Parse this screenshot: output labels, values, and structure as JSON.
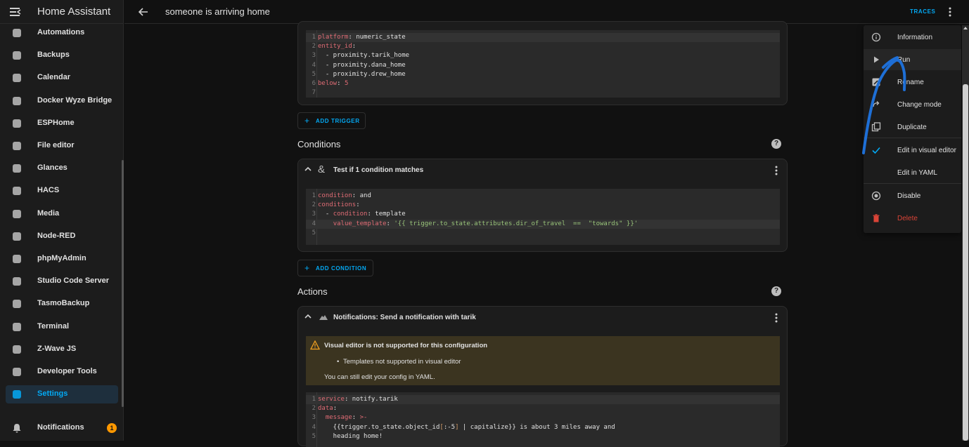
{
  "app": {
    "title": "Home Assistant"
  },
  "topbar": {
    "title": "someone is arriving home",
    "traces_label": "TRACES"
  },
  "sidebar": {
    "items": [
      {
        "label": "Automations",
        "icon": "robot-icon"
      },
      {
        "label": "Backups",
        "icon": "cloud-icon"
      },
      {
        "label": "Calendar",
        "icon": "calendar-icon"
      },
      {
        "label": "Docker Wyze Bridge",
        "icon": "puzzle-icon"
      },
      {
        "label": "ESPHome",
        "icon": "esphome-icon"
      },
      {
        "label": "File editor",
        "icon": "wrench-icon"
      },
      {
        "label": "Glances",
        "icon": "gauge-icon"
      },
      {
        "label": "HACS",
        "icon": "store-icon"
      },
      {
        "label": "Media",
        "icon": "media-icon"
      },
      {
        "label": "Node-RED",
        "icon": "sitemap-icon"
      },
      {
        "label": "phpMyAdmin",
        "icon": "database-icon"
      },
      {
        "label": "Studio Code Server",
        "icon": "vscode-icon"
      },
      {
        "label": "TasmoBackup",
        "icon": "restore-icon"
      },
      {
        "label": "Terminal",
        "icon": "terminal-icon"
      },
      {
        "label": "Z-Wave JS",
        "icon": "zwave-icon"
      },
      {
        "label": "Developer Tools",
        "icon": "hammer-icon"
      },
      {
        "label": "Settings",
        "icon": "gear-icon",
        "active": true
      }
    ],
    "notifications": {
      "label": "Notifications",
      "count": "1"
    }
  },
  "trigger_yaml": {
    "lines": [
      [
        [
          "platform",
          "k"
        ],
        [
          ": numeric_state",
          ""
        ]
      ],
      [
        [
          "entity_id",
          "k"
        ],
        [
          ":",
          ""
        ]
      ],
      [
        [
          "  - proximity.tarik_home",
          ""
        ]
      ],
      [
        [
          "  - proximity.dana_home",
          ""
        ]
      ],
      [
        [
          "  - proximity.drew_home",
          ""
        ]
      ],
      [
        [
          "below",
          "k"
        ],
        [
          ": ",
          ""
        ],
        [
          "5",
          "n"
        ]
      ],
      [
        [
          "",
          ""
        ]
      ]
    ]
  },
  "add_trigger_label": "ADD TRIGGER",
  "conditions": {
    "title": "Conditions",
    "card_title": "Test if 1 condition matches",
    "lines": [
      [
        [
          "condition",
          "k"
        ],
        [
          ": and",
          ""
        ]
      ],
      [
        [
          "conditions",
          "k"
        ],
        [
          ":",
          ""
        ]
      ],
      [
        [
          "  - ",
          ""
        ],
        [
          "condition",
          "k"
        ],
        [
          ": template",
          ""
        ]
      ],
      [
        [
          "    ",
          ""
        ],
        [
          "value_template",
          "k"
        ],
        [
          ": ",
          ""
        ],
        [
          "'{{ trigger.to_state.attributes.dir_of_travel  ==  \"towards\" }}'",
          "s"
        ]
      ],
      [
        [
          "",
          ""
        ]
      ]
    ],
    "add_label": "ADD CONDITION"
  },
  "actions": {
    "title": "Actions",
    "card_title": "Notifications: Send a notification with tarik",
    "warning": {
      "title": "Visual editor is not supported for this configuration",
      "bullet": "Templates not supported in visual editor",
      "sub": "You can still edit your config in YAML."
    },
    "lines": [
      [
        [
          "service",
          "k"
        ],
        [
          ": notify.tarik",
          ""
        ]
      ],
      [
        [
          "data",
          "k"
        ],
        [
          ":",
          ""
        ]
      ],
      [
        [
          "  ",
          ""
        ],
        [
          "message",
          "k"
        ],
        [
          ": ",
          ""
        ],
        [
          ">-",
          "k"
        ]
      ],
      [
        [
          "    {{trigger.to_state.object_id",
          ""
        ],
        [
          "[",
          "k2"
        ],
        [
          ":-5",
          ""
        ],
        [
          "]",
          "k2"
        ],
        [
          " | capitalize}} is about 3 miles away and",
          ""
        ]
      ],
      [
        [
          "    heading home!",
          ""
        ]
      ]
    ]
  },
  "menu": {
    "items": [
      {
        "label": "Information",
        "icon": "info-icon"
      },
      {
        "label": "Run",
        "icon": "play-icon"
      },
      {
        "label": "Rename",
        "icon": "rename-icon"
      },
      {
        "label": "Change mode",
        "icon": "redo-icon"
      },
      {
        "label": "Duplicate",
        "icon": "duplicate-icon"
      },
      {
        "label": "Edit in visual editor",
        "icon": "check-icon"
      },
      {
        "label": "Edit in YAML",
        "icon": ""
      },
      {
        "label": "Disable",
        "icon": "disable-icon"
      },
      {
        "label": "Delete",
        "icon": "trash-icon"
      }
    ]
  },
  "colors": {
    "accent": "#03a9f4",
    "danger": "#db4437",
    "badge": "#ff9800",
    "annotation": "#1e6fd6"
  }
}
